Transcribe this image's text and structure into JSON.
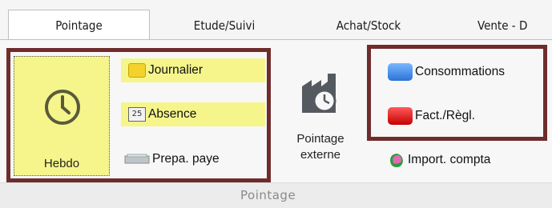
{
  "tabs": [
    {
      "label": "Pointage",
      "active": true
    },
    {
      "label": "Etude/Suivi",
      "active": false
    },
    {
      "label": "Achat/Stock",
      "active": false
    },
    {
      "label": "Vente - D",
      "active": false
    }
  ],
  "group": {
    "label": "Pointage"
  },
  "buttons": {
    "hebdo": "Hebdo",
    "journalier": "Journalier",
    "absence": "Absence",
    "absence_day": "25",
    "prepa_paye": "Prepa. paye",
    "pointage_externe_line1": "Pointage",
    "pointage_externe_line2": "externe",
    "consommations": "Consommations",
    "fact_regl": "Fact./Règl.",
    "import_compta": "Import. compta"
  },
  "colors": {
    "highlight_yellow": "#f5f58c",
    "frame_maroon": "#6f2c2c"
  }
}
